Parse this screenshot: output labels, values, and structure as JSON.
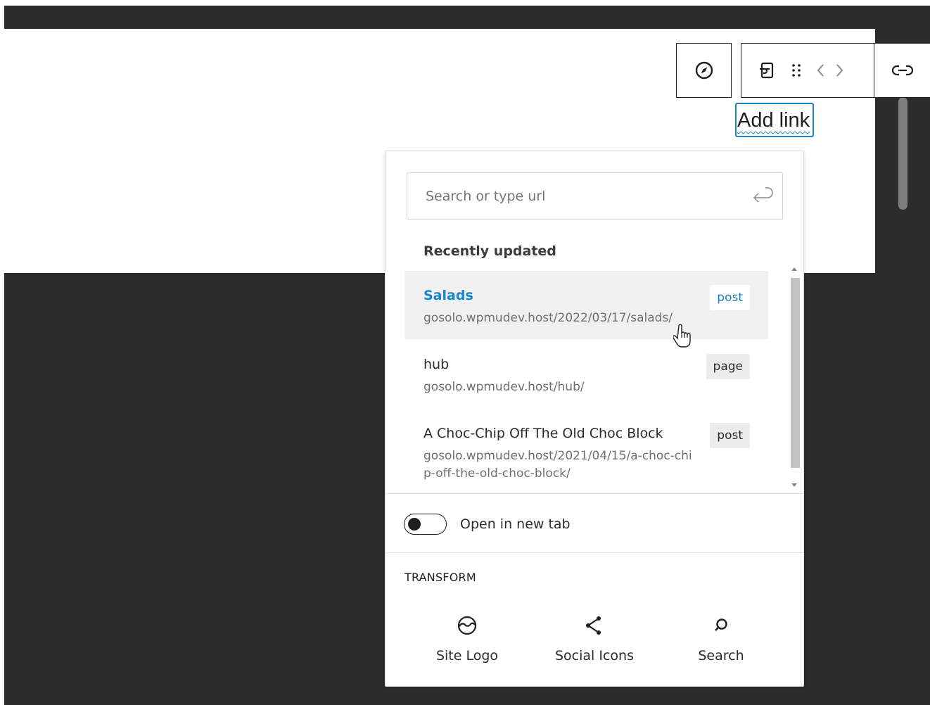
{
  "toolbar": {
    "compass_icon": "compass-icon",
    "transform_icon": "block-transform-icon",
    "drag_icon": "drag-handle-icon",
    "move_left_icon": "chevron-left-icon",
    "move_right_icon": "chevron-right-icon",
    "link_icon": "link-icon"
  },
  "link_text": "Add link",
  "popover": {
    "search": {
      "placeholder": "Search or type url",
      "value": ""
    },
    "recent_heading": "Recently updated",
    "results": [
      {
        "title": "Salads",
        "url": "gosolo.wpmudev.host/2022/03/17/salads/",
        "type": "post",
        "hovered": true
      },
      {
        "title": "hub",
        "url": "gosolo.wpmudev.host/hub/",
        "type": "page",
        "hovered": false
      },
      {
        "title": "A Choc-Chip Off The Old Choc Block",
        "url": "gosolo.wpmudev.host/2021/04/15/a-choc-chip-off-the-old-choc-block/",
        "type": "post",
        "hovered": false
      }
    ],
    "open_new_tab": {
      "label": "Open in new tab",
      "checked": false
    },
    "transform": {
      "heading": "TRANSFORM",
      "items": [
        {
          "label": "Site Logo",
          "icon": "site-logo-icon"
        },
        {
          "label": "Social Icons",
          "icon": "share-icon"
        },
        {
          "label": "Search",
          "icon": "search-icon"
        }
      ]
    }
  },
  "colors": {
    "accent": "#1b84c6",
    "frame_dark": "#2c2c2c",
    "hover_bg": "#f0f0f0"
  }
}
